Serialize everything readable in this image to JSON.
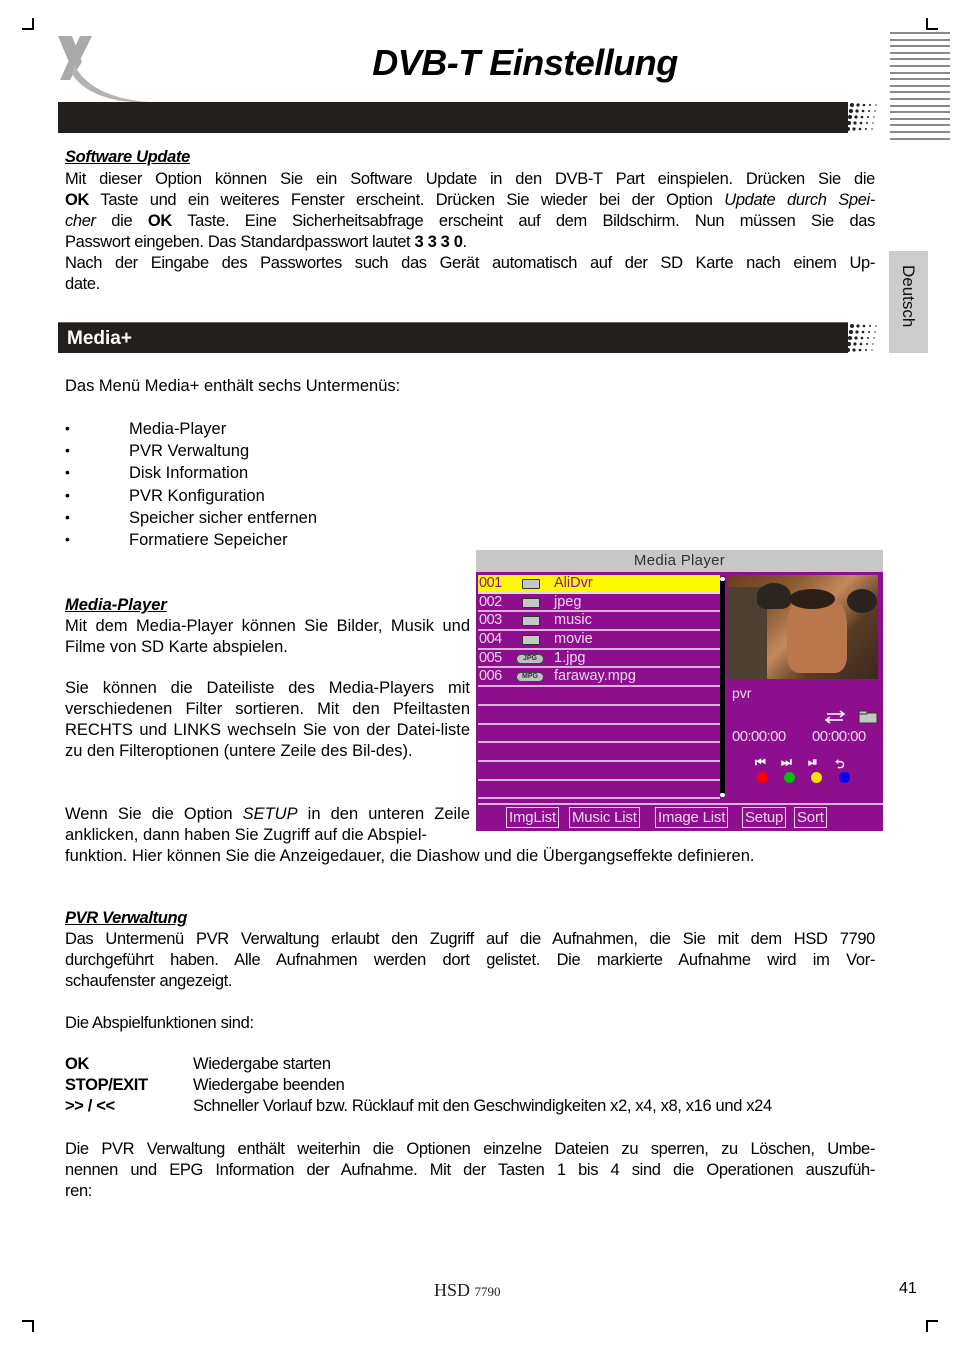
{
  "header": {
    "title": "DVB-T Einstellung",
    "lang_tab": "Deutsch"
  },
  "software_update": {
    "heading": "Software Update",
    "lines": [
      [
        "Mit dieser Option können Sie ein Software Update in den DVB-T Part einspielen. Drücken Sie die"
      ],
      [
        "OK",
        " Taste und ein weiteres Fenster erscheint. Drücken Sie wieder bei der Option ",
        "Update durch Spei-"
      ],
      [
        "cher",
        " die ",
        "OK",
        " Taste. Eine Sicherheitsabfrage erscheint auf dem Bildschirm. Nun müssen Sie das"
      ],
      [
        "Passwort eingeben. Das Standardpasswort lautet ",
        "3 3 3 0",
        "."
      ],
      [
        "Nach der Eingabe des Passwortes such das Gerät automatisch auf der SD Karte nach einem Up-"
      ],
      [
        "date."
      ]
    ],
    "l1": "Mit dieser Option können Sie ein Software Update in den DVB-T Part einspielen. Drücken Sie die",
    "l2_bold": "OK",
    "l2_text": " Taste und ein weiteres Fenster erscheint. Drücken Sie wieder bei der Option ",
    "l2_italic": "Update durch Spei-",
    "l3_italic": "cher",
    "l3_text1": " die ",
    "l3_bold": "OK",
    "l3_text2": " Taste. Eine Sicherheitsabfrage erscheint auf dem Bildschirm. Nun müssen Sie das",
    "l4_text": "Passwort eingeben. Das Standardpasswort lautet ",
    "l4_bold": "3 3 3 0",
    "l4_end": ".",
    "l5": "Nach der Eingabe des Passwortes such das Gerät automatisch auf der SD Karte nach einem Up-",
    "l6": "date."
  },
  "media_plus": {
    "heading": "Media+",
    "intro": "Das Menü Media+ enthält sechs Untermenüs:",
    "submenus": [
      "Media-Player",
      "PVR Verwaltung",
      "Disk Information",
      "PVR Konfiguration",
      "Speicher sicher entfernen",
      "Formatiere Sepeicher"
    ]
  },
  "media_player": {
    "heading": "Media-Player",
    "p1": "Mit dem Media-Player können Sie Bilder, Musik und Filme von SD Karte abspielen.",
    "p2": "Sie können die Dateiliste des Media-Players mit verschiedenen Filter sortieren. Mit den Pfeiltasten RECHTS und LINKS wechseln Sie von der Datei-liste zu den Filteroptionen (untere Zeile des Bil-des).",
    "p3_a": "Wenn Sie die Option ",
    "p3_italic": "SETUP",
    "p3_b": " in den unteren Zeile anklicken, dann haben Sie Zugriff auf die Abspiel-",
    "p3_c": "funktion. Hier können Sie die Anzeigedauer, die Diashow und die Übergangseffekte definieren."
  },
  "screenshot": {
    "title": "Media Player",
    "files": [
      {
        "num": "001",
        "type": "folder",
        "name": "AliDvr",
        "selected": true
      },
      {
        "num": "002",
        "type": "folder",
        "name": "jpeg",
        "selected": false
      },
      {
        "num": "003",
        "type": "folder",
        "name": "music",
        "selected": false
      },
      {
        "num": "004",
        "type": "folder",
        "name": "movie",
        "selected": false
      },
      {
        "num": "005",
        "type": "JPG",
        "name": "1.jpg",
        "selected": false
      },
      {
        "num": "006",
        "type": "MPG",
        "name": "faraway.mpg",
        "selected": false
      }
    ],
    "folder_label": "pvr",
    "time_current": "00:00:00",
    "time_total": "00:00:00",
    "controls": [
      {
        "icon": "previous-icon",
        "glyph": "⏮",
        "color": "#ff0000"
      },
      {
        "icon": "next-icon",
        "glyph": "⏭",
        "color": "#00c000"
      },
      {
        "icon": "play-pause-icon",
        "glyph": "⏯",
        "color": "#ffe000"
      },
      {
        "icon": "repeat-icon",
        "glyph": "⮌",
        "color": "#0000ff"
      }
    ],
    "tabs": [
      "ImgList",
      "Music List",
      "Image List",
      "Setup",
      "Sort"
    ],
    "colors": {
      "background": "#8d0f8e",
      "selection": "#fdfa00",
      "header": "#c7c7c7"
    }
  },
  "pvr": {
    "heading": "PVR Verwaltung",
    "p1_l1": "Das Untermenü PVR Verwaltung erlaubt den Zugriff auf die Aufnahmen, die Sie mit dem HSD 7790",
    "p1_l2": "durchgeführt haben. Alle Aufnahmen werden dort gelistet. Die markierte Aufnahme wird im Vor-",
    "p1_l3": "schaufenster angezeigt.",
    "p2": "Die Abspielfunktionen sind:",
    "functions": [
      {
        "key": "OK",
        "desc": "Wiedergabe starten"
      },
      {
        "key": "STOP/EXIT",
        "desc": "Wiedergabe beenden"
      },
      {
        "key": ">> / <<",
        "desc": "Schneller Vorlauf bzw. Rücklauf mit den Geschwindigkeiten x2, x4, x8, x16 und x24"
      }
    ],
    "p3_l1": "Die PVR Verwaltung enthält weiterhin die Optionen einzelne Dateien zu sperren, zu Löschen, Umbe-",
    "p3_l2": "nennen und EPG Information der Aufnahme. Mit der Tasten 1 bis 4 sind die Operationen auszufüh-",
    "p3_l3": "ren:"
  },
  "footer": {
    "model_brand": "HSD",
    "model_number": "7790",
    "page_number": "41"
  }
}
